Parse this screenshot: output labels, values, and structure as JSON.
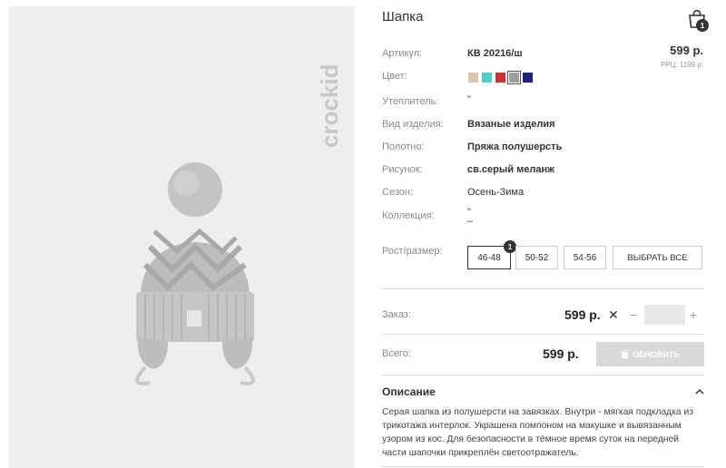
{
  "product": {
    "title": "Шапка",
    "brand": "crockid",
    "price": "599 р.",
    "rrc": "РРЦ: 1199 р."
  },
  "cart": {
    "icon": "shopping-bag-icon",
    "count": "1"
  },
  "attributes": [
    {
      "label": "Артикул:",
      "value": "КВ 20216/ш",
      "bold": true
    },
    {
      "label": "Цвет:",
      "value": "",
      "bold": false
    },
    {
      "label": "Утеплитель:",
      "value": "\"",
      "bold": false
    },
    {
      "label": "Вид изделия:",
      "value": "Вязаные изделия",
      "bold": true
    },
    {
      "label": "Полотно:",
      "value": "Пряжа полушерсть",
      "bold": true
    },
    {
      "label": "Рисунок:",
      "value": "св.серый меланж",
      "bold": true
    },
    {
      "label": "Сезон:",
      "value": "Осень-Зима",
      "bold": false
    },
    {
      "label": "Коллекция:",
      "value": "\"",
      "bold": false
    }
  ],
  "colors": [
    "#d9c9a8",
    "#4fd1c5",
    "#d32f2f",
    "#9e9e9e",
    "#1a237e"
  ],
  "sizes": {
    "label": "Рост/размер:",
    "options": [
      "46-48",
      "50-52",
      "54-56"
    ],
    "select_all": "ВЫБРАТЬ ВСЕ",
    "selected_count": "1"
  },
  "order": {
    "label": "Заказ:",
    "price": "599 р.",
    "times": "✕",
    "minus": "−",
    "plus": "+",
    "quantity": ""
  },
  "total": {
    "label": "Всего:",
    "price": "599 р.",
    "update_label": "ОБНОВИТЬ"
  },
  "description": {
    "title": "Описание",
    "text": "Серая шапка из полушерсти на завязках. Внутри - мягкая подкладка из трикотажа интерлок. Украшена помпоном на макушке и вывязанным узором из кос. Для безопасности в тёмное время суток на передней части шапочки прикреплён светоотражатель."
  }
}
